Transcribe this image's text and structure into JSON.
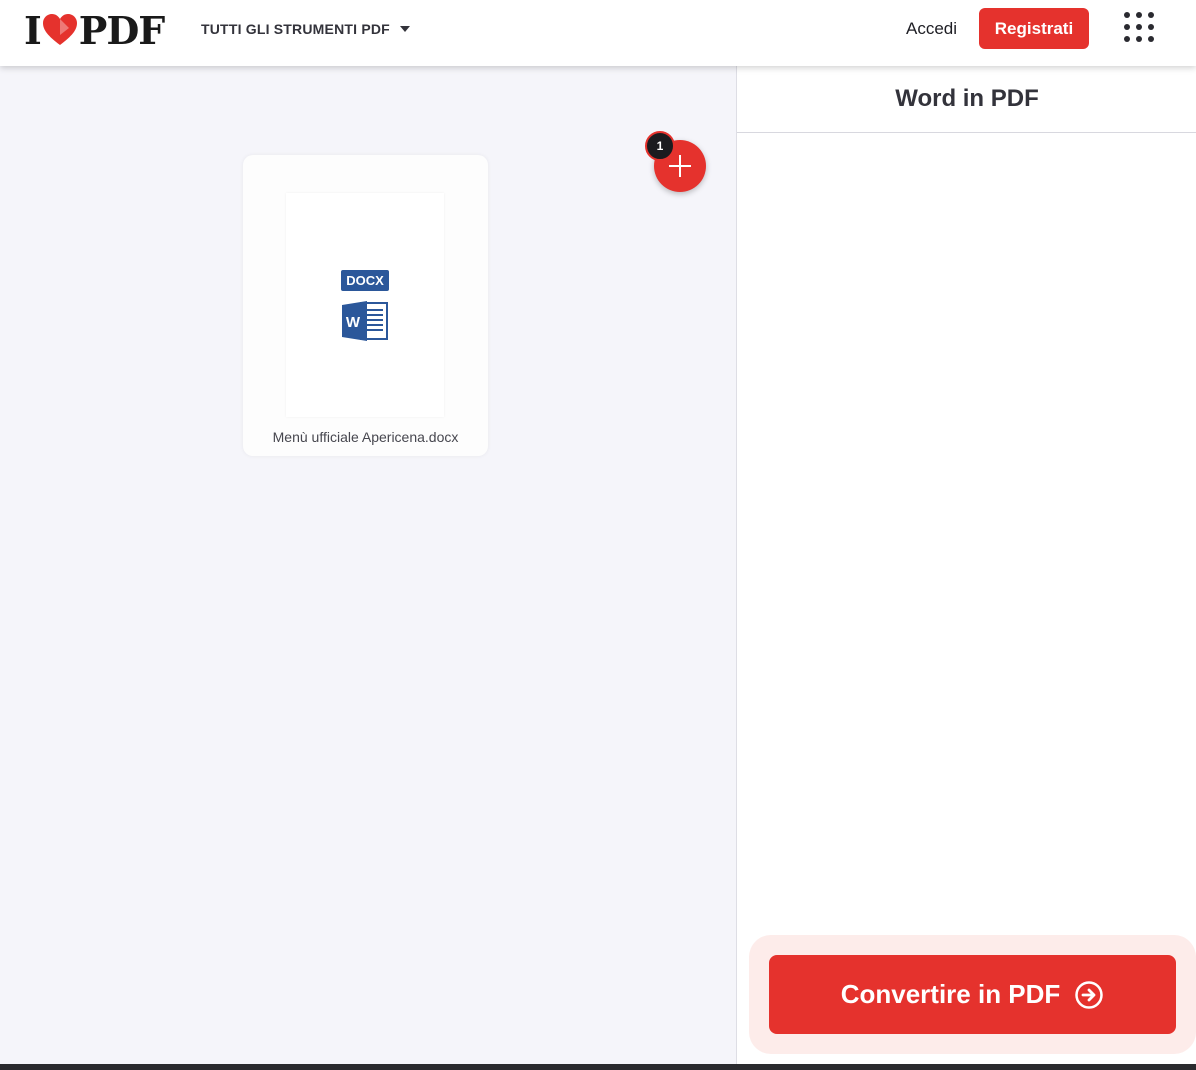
{
  "header": {
    "logo_left": "I",
    "logo_right": "PDF",
    "tools_menu_label": "TUTTI GLI STRUMENTI PDF",
    "login_label": "Accedi",
    "signup_label": "Registrati"
  },
  "workspace": {
    "file": {
      "name": "Menù ufficiale Apericena.docx",
      "type_badge": "DOCX",
      "word_letter": "W"
    },
    "file_count": "1"
  },
  "sidebar": {
    "title": "Word in PDF",
    "convert_label": "Convertire in PDF"
  },
  "colors": {
    "accent": "#e5322d",
    "word_blue": "#2b579a",
    "background": "#f5f5fa"
  },
  "icons": {
    "logo_heart": "heart-icon",
    "menu_caret": "caret-down-icon",
    "apps": "apps-grid-icon",
    "add": "plus-icon",
    "word": "word-doc-icon",
    "convert": "arrow-right-circle-icon"
  }
}
